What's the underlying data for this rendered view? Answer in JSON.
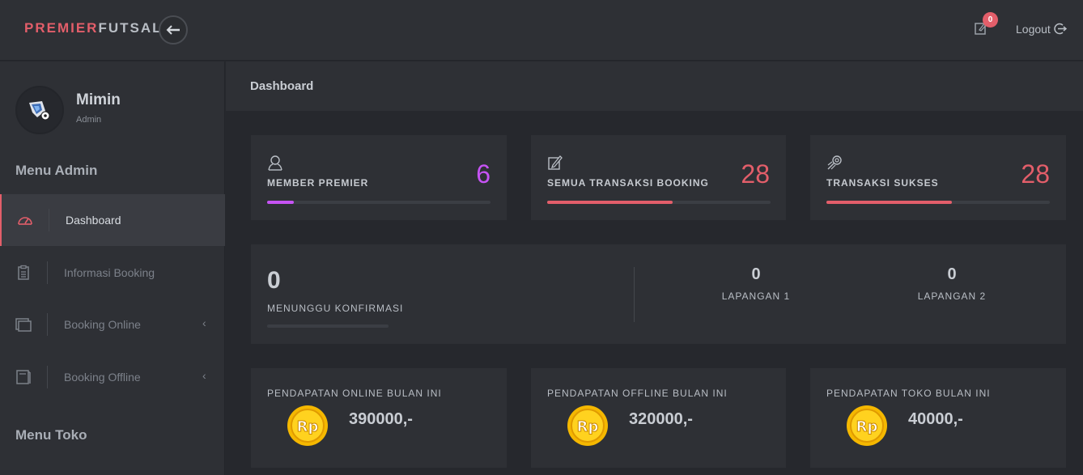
{
  "brand": {
    "part1": "PREMIER",
    "part2": "FUTSAL"
  },
  "topbar": {
    "notification_count": "0",
    "logout_label": "Logout"
  },
  "user": {
    "name": "Mimin",
    "role": "Admin"
  },
  "sidebar": {
    "menu_admin_title": "Menu Admin",
    "menu_toko_title": "Menu Toko",
    "items": [
      {
        "label": "Dashboard",
        "icon": "speedometer-icon",
        "active": true
      },
      {
        "label": "Informasi Booking",
        "icon": "clipboard-icon"
      },
      {
        "label": "Booking Online",
        "icon": "window-icon"
      },
      {
        "label": "Booking Offline",
        "icon": "book-icon"
      }
    ]
  },
  "page": {
    "title": "Dashboard"
  },
  "stats": [
    {
      "label": "MEMBER PREMIER",
      "value": "6",
      "icon": "user-icon",
      "color": "#c653f4",
      "progress": 0.12
    },
    {
      "label": "SEMUA TRANSAKSI BOOKING",
      "value": "28",
      "icon": "edit-icon",
      "color": "#e35e6a",
      "progress": 0.56
    },
    {
      "label": "TRANSAKSI SUKSES",
      "value": "28",
      "icon": "rocket-icon",
      "color": "#e35e6a",
      "progress": 0.56
    }
  ],
  "waiting": {
    "value": "0",
    "label": "MENUNGGU KONFIRMASI",
    "progress": 0,
    "fields": [
      {
        "value": "0",
        "label": "LAPANGAN 1"
      },
      {
        "value": "0",
        "label": "LAPANGAN 2"
      }
    ]
  },
  "income": [
    {
      "label": "PENDAPATAN ONLINE BULAN INI",
      "value": "390000,-",
      "icon": "rupiah-coin-icon",
      "coin_text": "Rp"
    },
    {
      "label": "PENDAPATAN OFFLINE BULAN INI",
      "value": "320000,-",
      "icon": "rupiah-coin-icon",
      "coin_text": "Rp"
    },
    {
      "label": "PENDAPATAN TOKO BULAN INI",
      "value": "40000,-",
      "icon": "rupiah-coin-icon",
      "coin_text": "Rp"
    }
  ],
  "colors": {
    "accent": "#e35e6a",
    "purple": "#c653f4",
    "coin": "#f5b800"
  }
}
